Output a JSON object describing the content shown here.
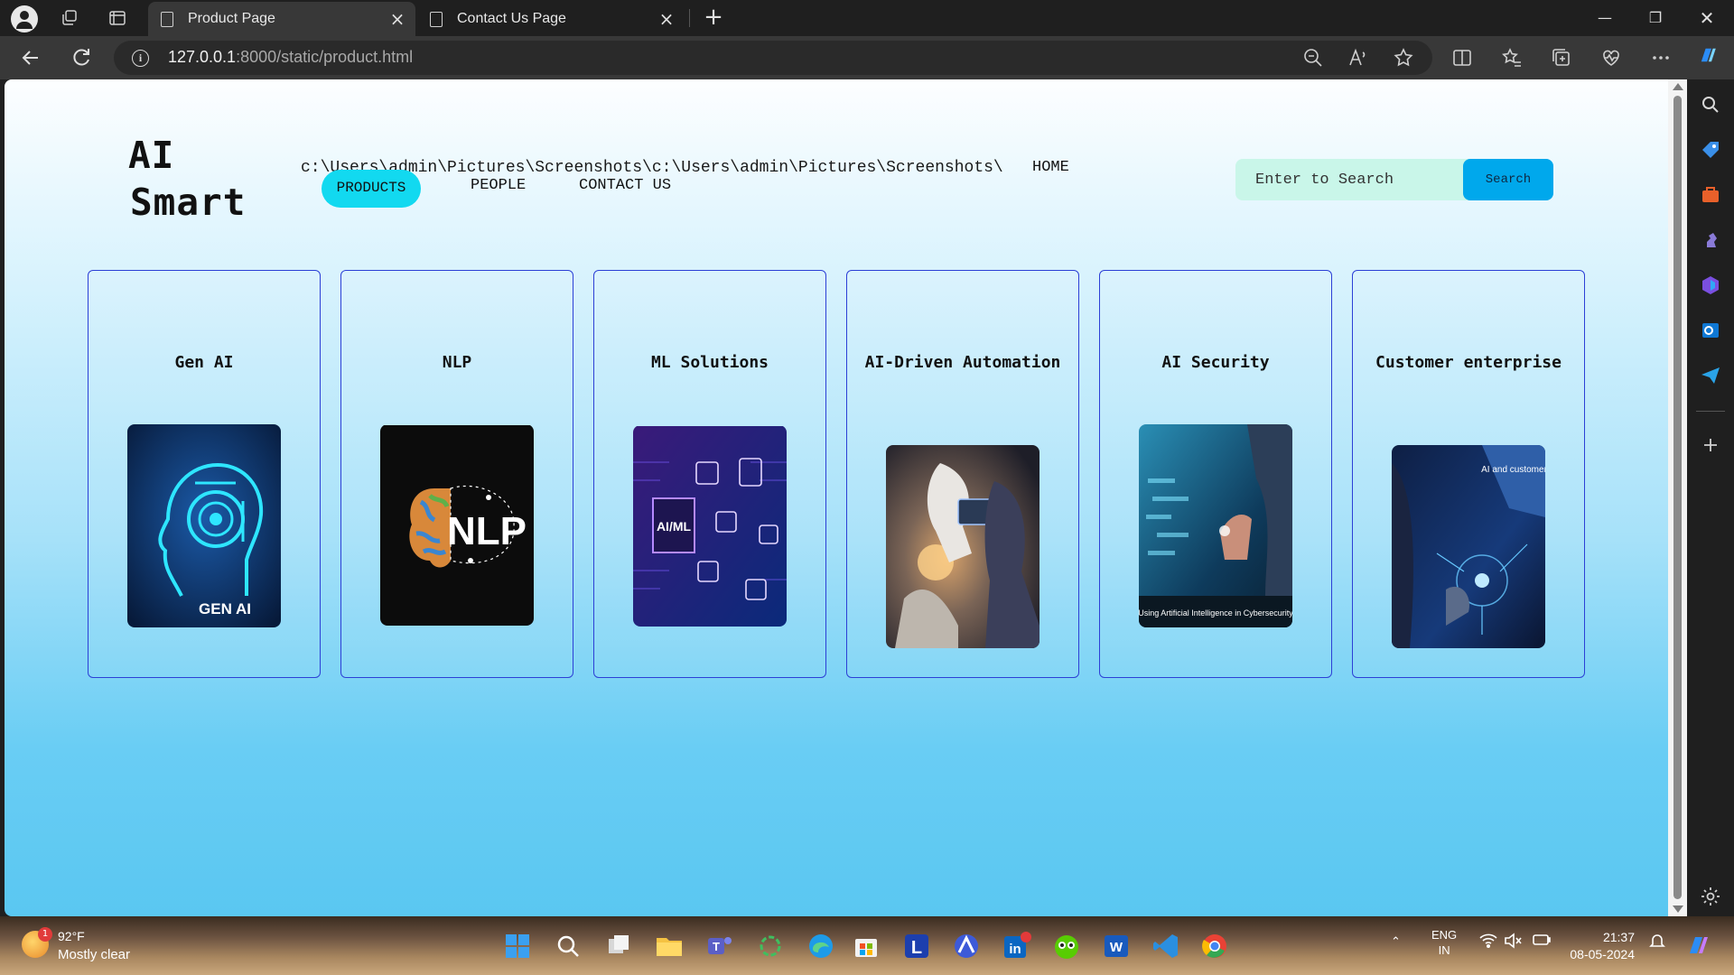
{
  "browser": {
    "tabs": [
      {
        "title": "Product Page",
        "active": true
      },
      {
        "title": "Contact Us Page",
        "active": false
      }
    ],
    "url_host": "127.0.0.1",
    "url_rest": ":8000/static/product.html"
  },
  "site": {
    "logo_line1": "AI",
    "logo_line2": "Smart",
    "path_text": "c:\\Users\\admin\\Pictures\\Screenshots\\c:\\Users\\admin\\Pictures\\Screenshots\\",
    "nav": {
      "home": "HOME",
      "products": "PRODUCTS",
      "people": "PEOPLE",
      "contact": "CONTACT US"
    },
    "search": {
      "placeholder": "Enter to Search",
      "button": "Search"
    },
    "cards": [
      {
        "title": "Gen AI",
        "image_caption": "GEN AI",
        "icon": "gen-ai-head-image"
      },
      {
        "title": "NLP",
        "image_caption": "NLP",
        "icon": "nlp-brain-image"
      },
      {
        "title": "ML Solutions",
        "image_caption": "AI/ML",
        "icon": "ml-circuit-image"
      },
      {
        "title": "AI-Driven Automation",
        "image_caption": "",
        "icon": "robot-automation-image"
      },
      {
        "title": "AI Security",
        "image_caption": "Using Artificial Intelligence in Cybersecurity",
        "icon": "ai-security-image"
      },
      {
        "title": "Customer enterprise",
        "image_caption": "AI and customers",
        "icon": "customer-enterprise-image"
      }
    ]
  },
  "taskbar": {
    "weather_temp": "92°F",
    "weather_cond": "Mostly clear",
    "weather_badge": "1",
    "lang_line1": "ENG",
    "lang_line2": "IN",
    "time": "21:37",
    "date": "08-05-2024"
  },
  "colors": {
    "nav_active": "#12d9f0",
    "search_bg": "#c9f6e9",
    "search_button": "#00a8ec",
    "card_border": "#2c3fd6"
  }
}
